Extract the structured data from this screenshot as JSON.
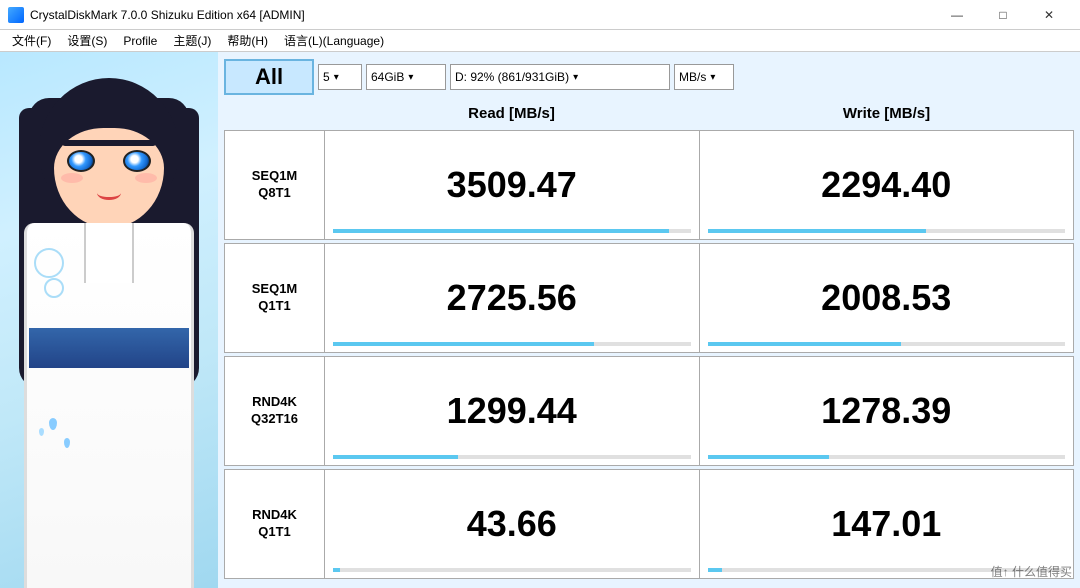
{
  "window": {
    "title": "CrystalDiskMark 7.0.0 Shizuku Edition x64 [ADMIN]",
    "title_icon": "disk-icon"
  },
  "titlebar": {
    "minimize_label": "—",
    "maximize_label": "□",
    "close_label": "✕"
  },
  "menubar": {
    "items": [
      {
        "id": "file",
        "label": "文件(F)"
      },
      {
        "id": "settings",
        "label": "设置(S)"
      },
      {
        "id": "profile",
        "label": "Profile"
      },
      {
        "id": "theme",
        "label": "主题(J)"
      },
      {
        "id": "help",
        "label": "帮助(H)"
      },
      {
        "id": "language",
        "label": "语言(L)(Language)"
      }
    ]
  },
  "controls": {
    "all_button": "All",
    "runs_value": "5",
    "size_value": "64GiB",
    "drive_value": "D: 92% (861/931GiB)",
    "unit_value": "MB/s",
    "runs_placeholder": "5",
    "size_placeholder": "64GiB",
    "drive_placeholder": "D: 92% (861/931GiB)",
    "unit_placeholder": "MB/s"
  },
  "columns": {
    "read_label": "Read [MB/s]",
    "write_label": "Write [MB/s]"
  },
  "rows": [
    {
      "id": "seq1m-q8t1",
      "label_line1": "SEQ1M",
      "label_line2": "Q8T1",
      "read_value": "3509.47",
      "write_value": "2294.40",
      "read_pct": 94,
      "write_pct": 61
    },
    {
      "id": "seq1m-q1t1",
      "label_line1": "SEQ1M",
      "label_line2": "Q1T1",
      "read_value": "2725.56",
      "write_value": "2008.53",
      "read_pct": 73,
      "write_pct": 54
    },
    {
      "id": "rnd4k-q32t16",
      "label_line1": "RND4K",
      "label_line2": "Q32T16",
      "read_value": "1299.44",
      "write_value": "1278.39",
      "read_pct": 35,
      "write_pct": 34
    },
    {
      "id": "rnd4k-q1t1",
      "label_line1": "RND4K",
      "label_line2": "Q1T1",
      "read_value": "43.66",
      "write_value": "147.01",
      "read_pct": 2,
      "write_pct": 4
    }
  ],
  "watermark": {
    "text": "值↑ 什么值得买"
  },
  "colors": {
    "bar_color": "#5bc8f0",
    "header_bg": "#c8e8ff",
    "border_color": "#aaa",
    "accent_blue": "#4a9fd4"
  }
}
